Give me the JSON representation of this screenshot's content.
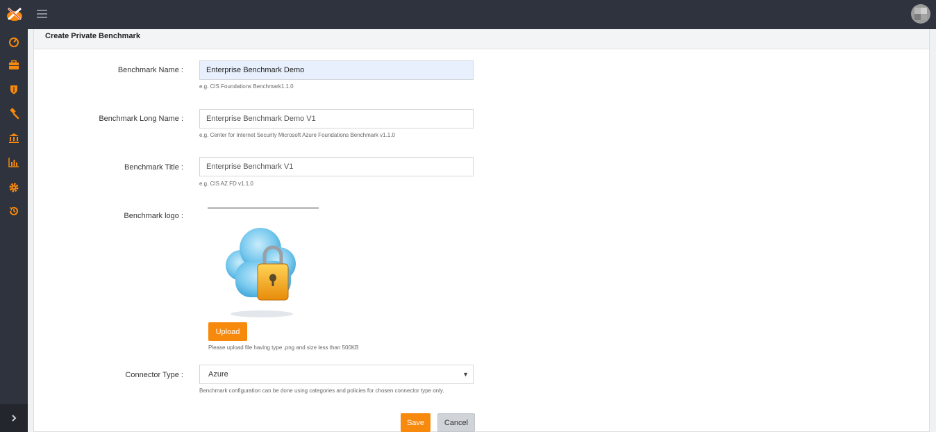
{
  "header": {
    "menu_icon": "hamburger-icon",
    "avatar_icon": "user-avatar"
  },
  "sidebar": {
    "items": [
      {
        "icon": "dashboard-gauge-icon"
      },
      {
        "icon": "briefcase-icon"
      },
      {
        "icon": "shield-icon"
      },
      {
        "icon": "gavel-icon"
      },
      {
        "icon": "bank-icon"
      },
      {
        "icon": "bar-chart-icon"
      },
      {
        "icon": "gear-icon"
      },
      {
        "icon": "history-icon"
      }
    ],
    "expand_icon": "chevron-right-icon",
    "accent": "#f7890c"
  },
  "form": {
    "title": "Create Private Benchmark",
    "name": {
      "label": "Benchmark Name :",
      "value": "Enterprise Benchmark Demo",
      "hint": "e.g. CIS Foundations Benchmark1.1.0"
    },
    "long_name": {
      "label": "Benchmark Long Name :",
      "value": "Enterprise Benchmark Demo V1",
      "hint": "e.g. Center for Internet Security Microsoft Azure Foundations Benchmark v1.1.0"
    },
    "title_field": {
      "label": "Benchmark Title :",
      "value": "Enterprise Benchmark V1",
      "hint": "e.g. CIS AZ FD v1.1.0"
    },
    "logo": {
      "label": "Benchmark logo :",
      "upload_label": "Upload",
      "hint": "Please upload file having type .png and size less than 500KB"
    },
    "connector": {
      "label": "Connector Type :",
      "value": "Azure",
      "hint": "Benchmark configuration can be done using categories and policies for chosen connector type only."
    },
    "save_label": "Save",
    "cancel_label": "Cancel"
  }
}
